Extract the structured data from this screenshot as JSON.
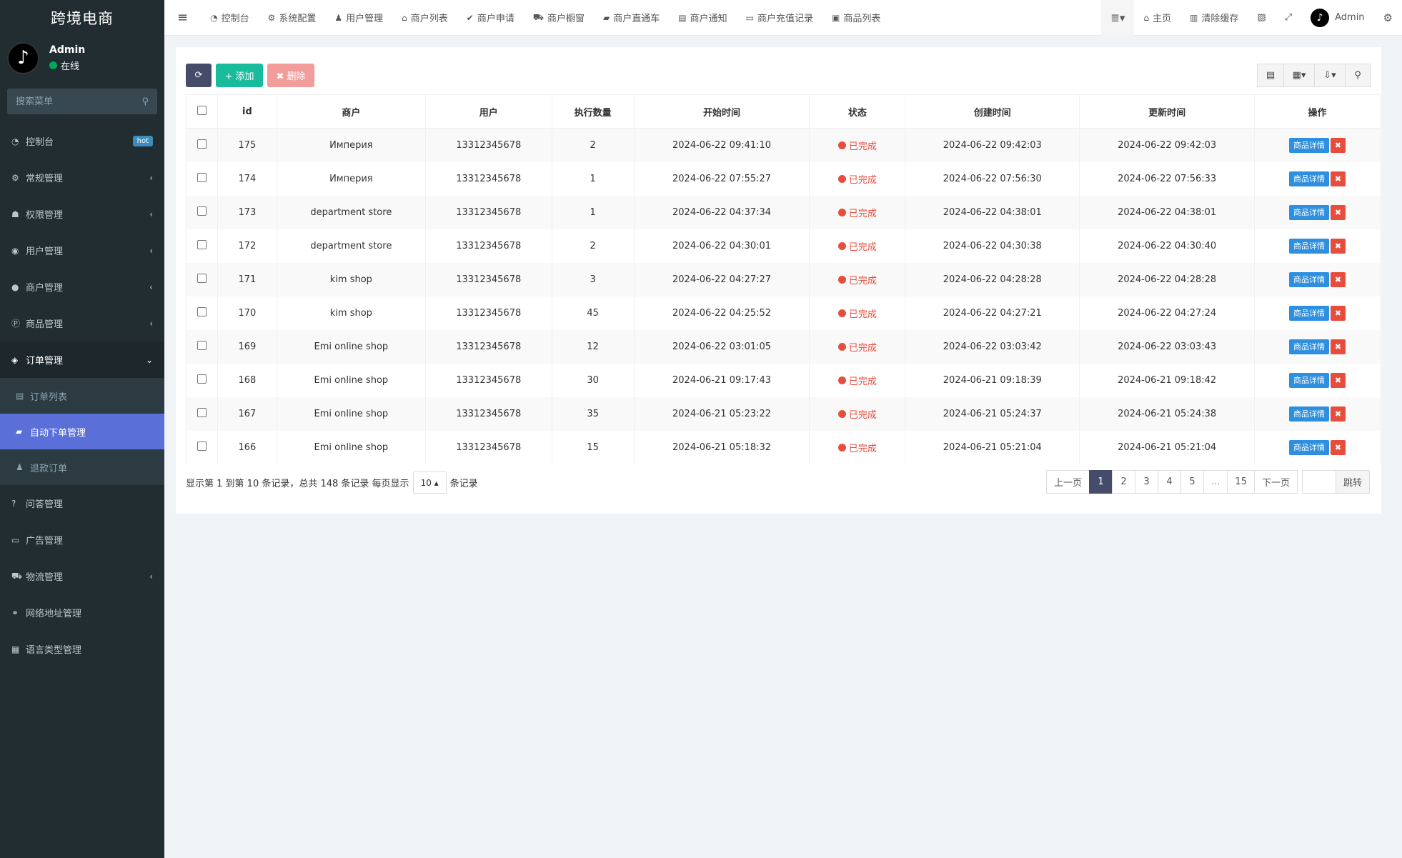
{
  "brand": "跨境电商",
  "user": {
    "name": "Admin",
    "status": "在线",
    "avatar_glyph": "♪"
  },
  "search": {
    "placeholder": "搜索菜单"
  },
  "sidebar": {
    "items": [
      {
        "icon": "dashboard-icon",
        "glyph": "◔",
        "label": "控制台",
        "badge": "hot"
      },
      {
        "icon": "cogs-icon",
        "glyph": "⚙",
        "label": "常规管理",
        "arrow": "‹"
      },
      {
        "icon": "group-icon",
        "glyph": "☗",
        "label": "权限管理",
        "arrow": "‹"
      },
      {
        "icon": "user-circle-icon",
        "glyph": "◉",
        "label": "用户管理",
        "arrow": "‹"
      },
      {
        "icon": "apple-icon",
        "glyph": "●",
        "label": "商户管理",
        "arrow": "‹"
      },
      {
        "icon": "product-icon",
        "glyph": "Ⓟ",
        "label": "商品管理",
        "arrow": "‹"
      },
      {
        "icon": "cube-icon",
        "glyph": "◈",
        "label": "订单管理",
        "arrow": "⌄"
      }
    ],
    "sub_items": [
      {
        "icon": "list-icon",
        "glyph": "▤",
        "label": "订单列表"
      },
      {
        "icon": "car-icon",
        "glyph": "▰",
        "label": "自动下单管理"
      },
      {
        "icon": "refund-icon",
        "glyph": "♟",
        "label": "退款订单"
      }
    ],
    "items_after": [
      {
        "icon": "question-icon",
        "glyph": "?",
        "label": "问答管理"
      },
      {
        "icon": "ad-icon",
        "glyph": "▭",
        "label": "广告管理"
      },
      {
        "icon": "truck-icon",
        "glyph": "⛟",
        "label": "物流管理",
        "arrow": "‹"
      },
      {
        "icon": "link-icon",
        "glyph": "⚭",
        "label": "网络地址管理"
      },
      {
        "icon": "language-icon",
        "glyph": "▦",
        "label": "语言类型管理"
      }
    ]
  },
  "topbar": {
    "menu_glyph": "≡",
    "items": [
      {
        "icon": "dashboard-icon",
        "glyph": "◔",
        "label": "控制台"
      },
      {
        "icon": "cogs-icon",
        "glyph": "⚙",
        "label": "系统配置"
      },
      {
        "icon": "user-icon",
        "glyph": "♟",
        "label": "用户管理"
      },
      {
        "icon": "home-icon",
        "glyph": "⌂",
        "label": "商户列表"
      },
      {
        "icon": "check-circle-icon",
        "glyph": "✔",
        "label": "商户申请"
      },
      {
        "icon": "cart-icon",
        "glyph": "⛟",
        "label": "商户橱窗"
      },
      {
        "icon": "car-icon",
        "glyph": "▰",
        "label": "商户直通车"
      },
      {
        "icon": "notice-icon",
        "glyph": "▤",
        "label": "商户通知"
      },
      {
        "icon": "money-icon",
        "glyph": "▭",
        "label": "商户充值记录"
      },
      {
        "icon": "bag-icon",
        "glyph": "▣",
        "label": "商品列表"
      }
    ],
    "right": {
      "home": "主页",
      "clear_cache": "清除缓存",
      "admin": "Admin"
    }
  },
  "toolbar": {
    "refresh_glyph": "⟳",
    "add": "+ 添加",
    "delete": "✖ 删除"
  },
  "table": {
    "headers": [
      "id",
      "商户",
      "用户",
      "执行数量",
      "开始时间",
      "状态",
      "创建时间",
      "更新时间",
      "操作"
    ],
    "detail_label": "商品详情",
    "delete_glyph": "✖",
    "rows": [
      {
        "id": "175",
        "merchant": "Империя",
        "user": "13312345678",
        "qty": "2",
        "start": "2024-06-22 09:41:10",
        "status": "已完成",
        "created": "2024-06-22 09:42:03",
        "updated": "2024-06-22 09:42:03"
      },
      {
        "id": "174",
        "merchant": "Империя",
        "user": "13312345678",
        "qty": "1",
        "start": "2024-06-22 07:55:27",
        "status": "已完成",
        "created": "2024-06-22 07:56:30",
        "updated": "2024-06-22 07:56:33"
      },
      {
        "id": "173",
        "merchant": "department store",
        "user": "13312345678",
        "qty": "1",
        "start": "2024-06-22 04:37:34",
        "status": "已完成",
        "created": "2024-06-22 04:38:01",
        "updated": "2024-06-22 04:38:01"
      },
      {
        "id": "172",
        "merchant": "department store",
        "user": "13312345678",
        "qty": "2",
        "start": "2024-06-22 04:30:01",
        "status": "已完成",
        "created": "2024-06-22 04:30:38",
        "updated": "2024-06-22 04:30:40"
      },
      {
        "id": "171",
        "merchant": "kim shop",
        "user": "13312345678",
        "qty": "3",
        "start": "2024-06-22 04:27:27",
        "status": "已完成",
        "created": "2024-06-22 04:28:28",
        "updated": "2024-06-22 04:28:28"
      },
      {
        "id": "170",
        "merchant": "kim shop",
        "user": "13312345678",
        "qty": "45",
        "start": "2024-06-22 04:25:52",
        "status": "已完成",
        "created": "2024-06-22 04:27:21",
        "updated": "2024-06-22 04:27:24"
      },
      {
        "id": "169",
        "merchant": "Emi online shop",
        "user": "13312345678",
        "qty": "12",
        "start": "2024-06-22 03:01:05",
        "status": "已完成",
        "created": "2024-06-22 03:03:42",
        "updated": "2024-06-22 03:03:43"
      },
      {
        "id": "168",
        "merchant": "Emi online shop",
        "user": "13312345678",
        "qty": "30",
        "start": "2024-06-21 09:17:43",
        "status": "已完成",
        "created": "2024-06-21 09:18:39",
        "updated": "2024-06-21 09:18:42"
      },
      {
        "id": "167",
        "merchant": "Emi online shop",
        "user": "13312345678",
        "qty": "35",
        "start": "2024-06-21 05:23:22",
        "status": "已完成",
        "created": "2024-06-21 05:24:37",
        "updated": "2024-06-21 05:24:38"
      },
      {
        "id": "166",
        "merchant": "Emi online shop",
        "user": "13312345678",
        "qty": "15",
        "start": "2024-06-21 05:18:32",
        "status": "已完成",
        "created": "2024-06-21 05:21:04",
        "updated": "2024-06-21 05:21:04"
      }
    ]
  },
  "footer": {
    "info": "显示第 1 到第 10 条记录，总共 148 条记录 每页显示",
    "page_size": "10 ▴",
    "info_suffix": "条记录"
  },
  "pager": {
    "prev": "上一页",
    "pages": [
      "1",
      "2",
      "3",
      "4",
      "5",
      "...",
      "15"
    ],
    "active": "1",
    "next": "下一页",
    "go": "跳转"
  },
  "colors": {
    "sidebar_bg": "#222d32",
    "active_item": "#5b6fd8",
    "add_button": "#18bc9c",
    "status_red": "#e74c3c",
    "detail_button": "#2d8fe0"
  }
}
